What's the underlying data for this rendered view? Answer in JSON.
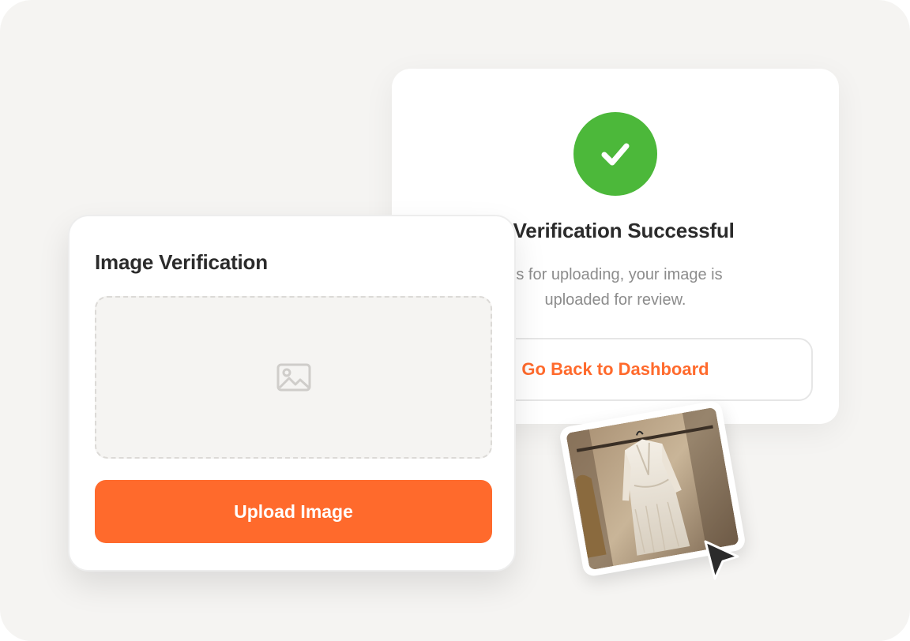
{
  "colors": {
    "accent": "#ff6a2c",
    "success": "#4cb83a",
    "background": "#f5f4f2",
    "card": "#ffffff"
  },
  "success_card": {
    "icon": "check-icon",
    "title": "e Verification Successful",
    "message": "ks for uploading, your image is uploaded for review.",
    "dashboard_button": "Go Back to Dashboard"
  },
  "upload_card": {
    "title": "Image Verification",
    "dropzone_icon": "image-placeholder-icon",
    "upload_button": "Upload Image"
  },
  "photo": {
    "subject": "white dress on hanger"
  },
  "cursor": {
    "icon": "mouse-pointer-icon"
  }
}
